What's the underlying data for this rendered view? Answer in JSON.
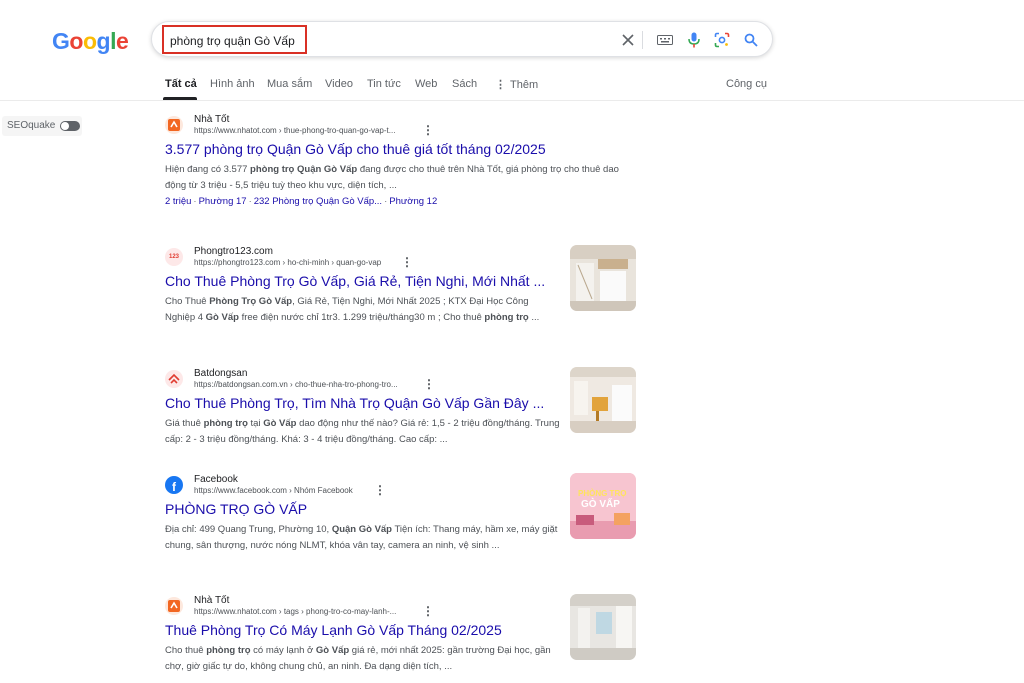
{
  "logo": {
    "letters": [
      "G",
      "o",
      "o",
      "g",
      "l",
      "e"
    ],
    "colors": [
      "#4285F4",
      "#EA4335",
      "#FBBC05",
      "#4285F4",
      "#34A853",
      "#EA4335"
    ]
  },
  "search": {
    "query": "phòng trọ quận Gò Vấp",
    "highlight_color": "#d93025"
  },
  "tabs": [
    {
      "label": "Tất cả"
    },
    {
      "label": "Hình ảnh"
    },
    {
      "label": "Mua sắm"
    },
    {
      "label": "Video"
    },
    {
      "label": "Tin tức"
    },
    {
      "label": "Web"
    },
    {
      "label": "Sách"
    },
    {
      "label": "Thêm"
    }
  ],
  "tools_label": "Công cụ",
  "seoquake": {
    "label": "SEOquake"
  },
  "results": [
    {
      "site": "Nhà Tốt",
      "url": "https://www.nhatot.com › thue-phong-tro-quan-go-vap-t...",
      "title": "3.577 phòng trọ Quận Gò Vấp cho thuê giá tốt tháng 02/2025",
      "snippet": [
        "Hiện đang có 3.577 ",
        "phòng trọ Quận Gò Vấp",
        " đang được cho thuê trên Nhà Tốt, giá phòng trọ cho thuê dao động từ 3 triệu - 5,5 triệu tuỳ theo khu vực, diện tích, ..."
      ],
      "sitelinks": [
        "2 triệu",
        "Phường 17",
        "232 Phòng trọ Quận Gò Vấp...",
        "Phường 12"
      ]
    },
    {
      "site": "Phongtro123.com",
      "url": "https://phongtro123.com › ho-chi-minh › quan-go-vap",
      "title": "Cho Thuê Phòng Trọ Gò Vấp, Giá Rẻ, Tiện Nghi, Mới Nhất ...",
      "snippet": [
        "Cho Thuê ",
        "Phòng Trọ Gò Vấp",
        ", Giá Rẻ, Tiện Nghi, Mới Nhất 2025 ; KTX Đại Học Công Nghiệp 4 ",
        "Gò Vấp",
        " free điện nước chỉ 1tr3. 1.299 triệu/tháng30 m ; Cho thuê ",
        "phòng trọ",
        " ..."
      ]
    },
    {
      "site": "Batdongsan",
      "url": "https://batdongsan.com.vn › cho-thue-nha-tro-phong-tro...",
      "title": "Cho Thuê Phòng Trọ, Tìm Nhà Trọ Quận Gò Vấp Gần Đây ...",
      "snippet": [
        "Giá thuê ",
        "phòng trọ",
        " tại ",
        "Gò Vấp",
        " dao động như thế nào? Giá rẻ: 1,5 - 2 triệu đồng/tháng. Trung cấp: 2 - 3 triệu đồng/tháng. Khá: 3 - 4 triệu đồng/tháng. Cao cấp: ..."
      ]
    },
    {
      "site": "Facebook",
      "url": "https://www.facebook.com › Nhóm Facebook",
      "title": "PHÒNG TRỌ GÒ VẤP",
      "snippet": [
        "Địa chỉ: 499 Quang Trung, Phường 10, ",
        "Quận Gò Vấp",
        " Tiện ích: Thang máy, hầm xe, máy giặt chung, sân thượng, nước nóng NLMT, khóa vân tay, camera an ninh, vệ sinh ..."
      ],
      "thumb_text": [
        "PHÒNG TRỌ",
        "GÒ VẤP"
      ]
    },
    {
      "site": "Nhà Tốt",
      "url": "https://www.nhatot.com › tags › phong-tro-co-may-lanh-...",
      "title": "Thuê Phòng Trọ Có Máy Lạnh Gò Vấp Tháng 02/2025",
      "snippet": [
        "Cho thuê ",
        "phòng trọ",
        " có máy lạnh ở ",
        "Gò Vấp",
        " giá rẻ, mới nhất 2025: gần trường Đại học, gần chợ, giờ giấc tự do, không chung chủ, an ninh. Đa dạng diện tích, ..."
      ]
    }
  ]
}
